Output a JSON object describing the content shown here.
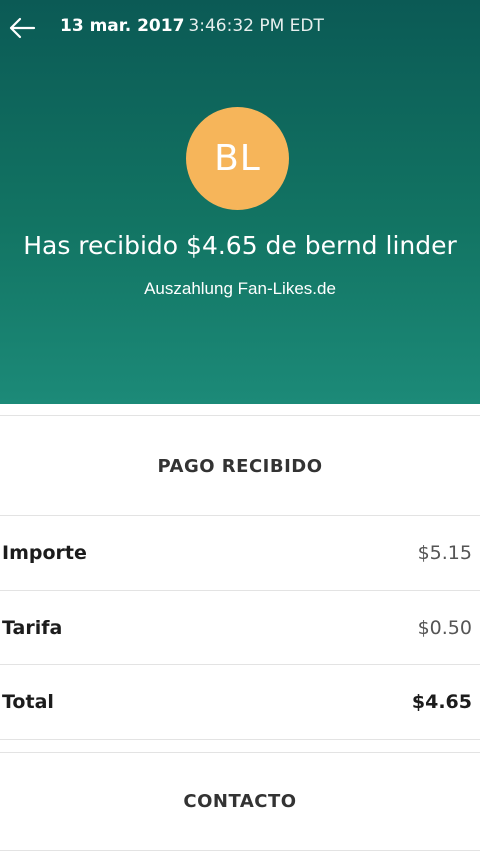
{
  "header": {
    "date": "13 mar. 2017",
    "time": "3:46:32 PM EDT",
    "back_icon": "arrow-left-icon"
  },
  "transaction": {
    "avatar_initials": "BL",
    "headline": "Has recibido $4.65 de bernd linder",
    "note": "Auszahlung Fan-Likes.de"
  },
  "payment": {
    "title": "PAGO RECIBIDO",
    "rows": [
      {
        "label": "Importe",
        "value": "$5.15"
      },
      {
        "label": "Tarifa",
        "value": "$0.50"
      },
      {
        "label": "Total",
        "value": "$4.65"
      }
    ]
  },
  "contact": {
    "title": "CONTACTO"
  },
  "colors": {
    "header_gradient_top": "#0b5a55",
    "header_gradient_bottom": "#1c8a78",
    "avatar": "#f6b55a"
  }
}
